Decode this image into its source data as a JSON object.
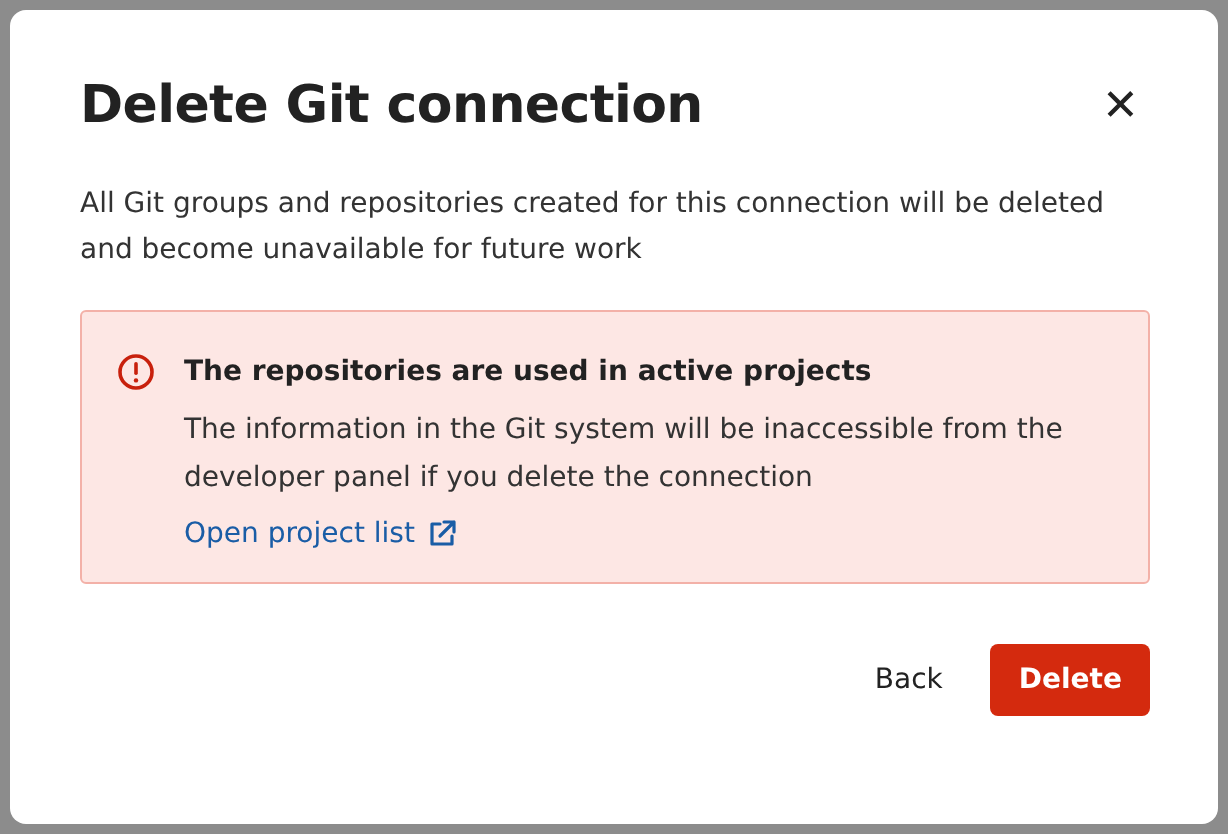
{
  "dialog": {
    "title": "Delete Git connection",
    "close": "✕",
    "description": "All Git groups and repositories created for this connection will be deleted and become unavailable for future work"
  },
  "alert": {
    "title": "The repositories are used in active projects",
    "text": "The information in the Git system will be inaccessible from the developer panel if you delete the connection",
    "link": "Open project list"
  },
  "buttons": [
    {
      "label": "Back",
      "kind": "secondary"
    },
    {
      "label": "Delete",
      "kind": "danger"
    }
  ]
}
